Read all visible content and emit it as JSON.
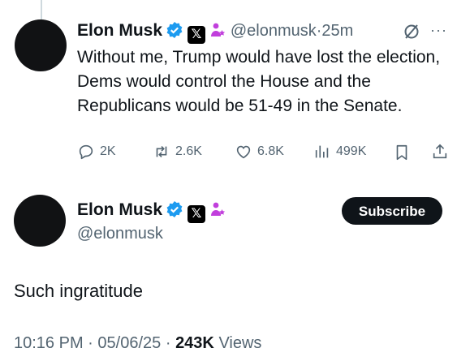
{
  "tweet1": {
    "name": "Elon Musk",
    "handle": "@elonmusk",
    "separator": "·",
    "time": "25m",
    "text": "Without me, Trump would have lost the election, Dems would control the House and the Republicans would be 51-49 in the Senate.",
    "actions": {
      "replies": "2K",
      "reposts": "2.6K",
      "likes": "6.8K",
      "views": "499K"
    }
  },
  "tweet2": {
    "name": "Elon Musk",
    "handle": "@elonmusk",
    "subscribe_label": "Subscribe",
    "text": "Such ingratitude",
    "time": "10:16 PM",
    "sep1": "·",
    "date": "05/06/25",
    "sep2": "·",
    "views_count": "243K",
    "views_label": "Views"
  },
  "badge_x": "𝕏",
  "colors": {
    "verified": "#1d9bf0",
    "affiliate": "#c13fdc",
    "text": "#0f1419",
    "muted": "#536471"
  },
  "icons": [
    "reply-icon",
    "repost-icon",
    "like-icon",
    "views-icon",
    "bookmark-icon",
    "share-icon",
    "grok-icon",
    "more-icon",
    "verified-icon",
    "x-badge-icon",
    "affiliate-icon"
  ]
}
